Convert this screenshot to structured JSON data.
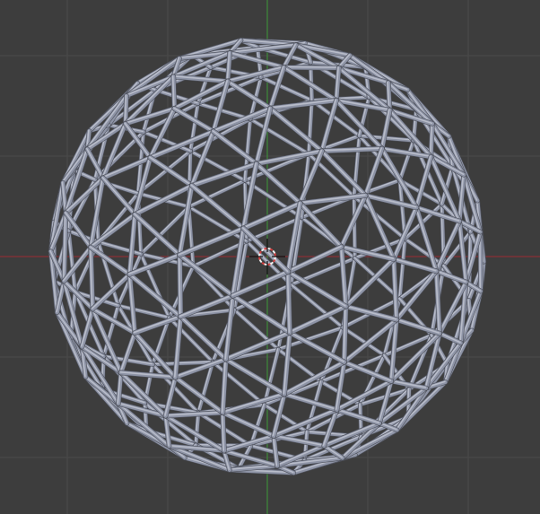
{
  "viewport": {
    "background": "#3d3d3d",
    "grid_color": "#4a4a4a",
    "x_axis_color": "#8a2f35",
    "y_axis_color": "#3e8a3a",
    "mesh_color": "#8e94a6",
    "mesh_highlight": "#b9bdca",
    "mesh_shadow": "#4b4e58",
    "cursor_primary": "#d44040",
    "cursor_secondary": "#f2f2f2",
    "object_icon": "geodesic-sphere-wireframe-icon",
    "cursor_icon": "3d-cursor-icon"
  }
}
